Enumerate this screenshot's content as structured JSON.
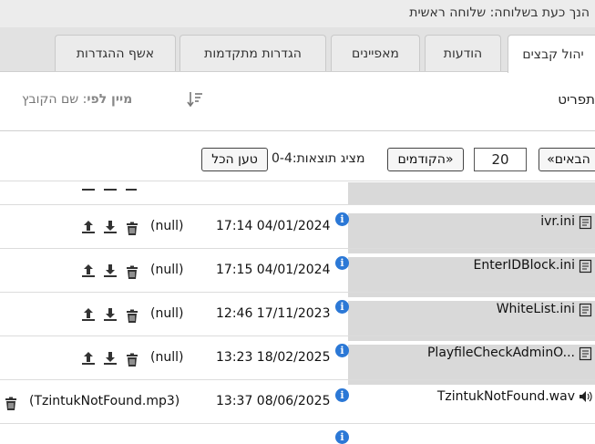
{
  "title": "הנך כעת בשלוחה: שלוחה ראשית",
  "tabs": [
    {
      "label": "יהול קבצים",
      "active": true
    },
    {
      "label": "הודעות"
    },
    {
      "label": "מאפיינים"
    },
    {
      "label": "הגדרות מתקדמות"
    },
    {
      "label": "אשף ההגדרות"
    }
  ],
  "toolbar": {
    "menu_label": "תפריט",
    "sort_prefix": "מיין לפי",
    "sort_value": ": שם הקובץ"
  },
  "pager": {
    "next_label": "«הבאים",
    "page_size": "20",
    "prev_label": "הקודמים»",
    "status": "מציג תוצאות:0-4",
    "load_all_label": "טען הכל"
  },
  "rows": [
    {
      "name": "ivr.ini",
      "datetime": "17:14 04/01/2024",
      "note": "(null)",
      "type": "text"
    },
    {
      "name": "EnterIDBlock.ini",
      "datetime": "17:15 04/01/2024",
      "note": "(null)",
      "type": "text"
    },
    {
      "name": "WhiteList.ini",
      "datetime": "12:46 17/11/2023",
      "note": "(null)",
      "type": "text"
    },
    {
      "name": "PlayfileCheckAdminO...",
      "datetime": "13:23 18/02/2025",
      "note": "(null)",
      "type": "text"
    },
    {
      "name": "TzintukNotFound.wav",
      "datetime": "13:37 08/06/2025",
      "note": "(TzintukNotFound.mp3)",
      "type": "audio"
    }
  ],
  "colors": {
    "info": "#2b78d6",
    "highlight": "#d9d9d9"
  }
}
